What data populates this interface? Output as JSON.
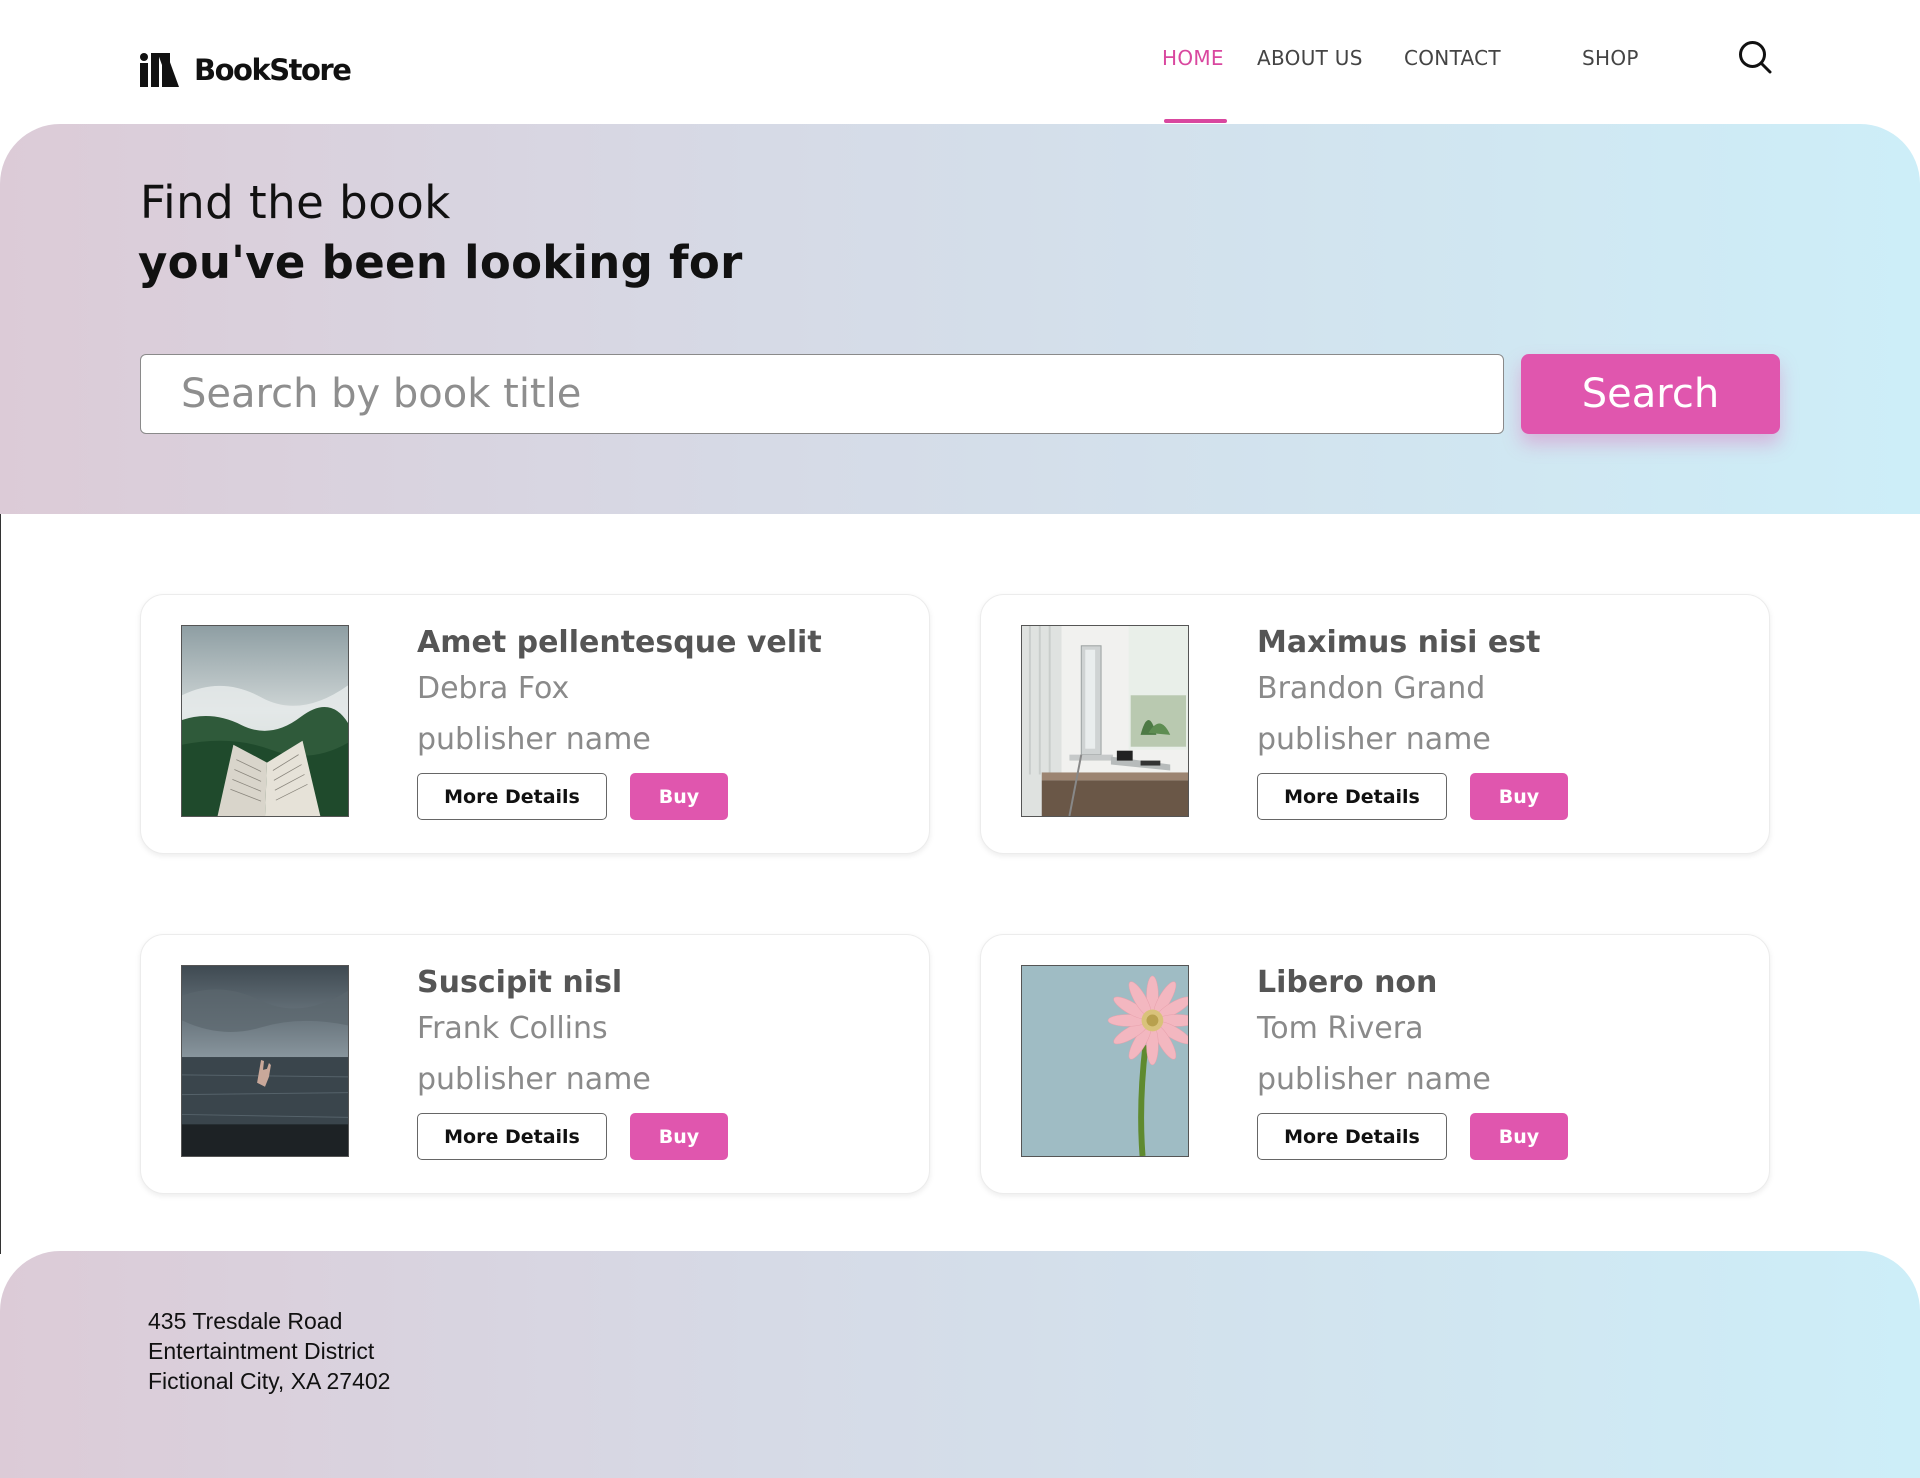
{
  "brand": {
    "name": "BookStore"
  },
  "nav": {
    "home": "HOME",
    "about": "ABOUT US",
    "contact": "CONTACT",
    "shop": "SHOP",
    "active": "HOME"
  },
  "hero": {
    "line1": "Find the book",
    "line2": "you've been looking for",
    "search_placeholder": "Search by book title",
    "search_button": "Search"
  },
  "books": [
    {
      "title": "Amet pellentesque velit",
      "author": "Debra Fox",
      "publisher": "publisher name",
      "cover": "misty-forest-open-book",
      "details_label": "More Details",
      "buy_label": "Buy"
    },
    {
      "title": "Maximus nisi est",
      "author": "Brandon Grand",
      "publisher": "publisher name",
      "cover": "desk-with-computer",
      "details_label": "More Details",
      "buy_label": "Buy"
    },
    {
      "title": "Suscipit nisl",
      "author": "Frank Collins",
      "publisher": "publisher name",
      "cover": "hand-in-stormy-sea",
      "details_label": "More Details",
      "buy_label": "Buy"
    },
    {
      "title": "Libero non",
      "author": "Tom Rivera",
      "publisher": "publisher name",
      "cover": "pink-gerbera-flower",
      "details_label": "More Details",
      "buy_label": "Buy"
    }
  ],
  "footer": {
    "address_line1": "435 Tresdale Road",
    "address_line2": "Entertaintment District",
    "address_line3": "Fictional City, XA 27402"
  },
  "colors": {
    "accent": "#e056ae",
    "nav_active": "#d9479f",
    "gradient_start": "#dccbd7",
    "gradient_end": "#cdeef8"
  }
}
